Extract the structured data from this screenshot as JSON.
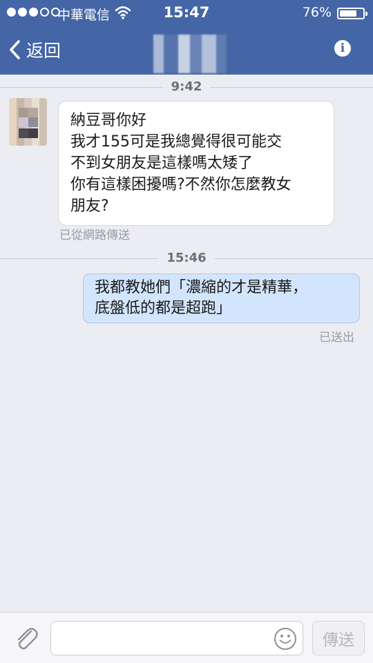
{
  "status_bar": {
    "carrier": "中華電信",
    "time": "15:47",
    "battery_text": "76%",
    "battery_level": 0.76,
    "signal_dots_filled": 3,
    "signal_dots_total": 5
  },
  "nav": {
    "back_label": "返回",
    "icons": {
      "back": "chevron-left-icon",
      "info": "info-icon"
    }
  },
  "conversation": {
    "divider_1_time": "9:42",
    "incoming": {
      "lines": [
        "納豆哥你好",
        "我才155可是我總覺得很可能交",
        "不到女朋友是這樣嗎太矮了",
        "你有這樣困擾嗎?不然你怎麼教女",
        "朋友?"
      ],
      "status": "已從網路傳送"
    },
    "divider_2_time": "15:46",
    "outgoing": {
      "lines": [
        "我都教她們「濃縮的才是精華，",
        "底盤低的都是超跑」"
      ],
      "status": "已送出"
    }
  },
  "input_bar": {
    "placeholder": "",
    "value": "",
    "send_label": "傳送",
    "icons": {
      "attach": "paperclip-icon",
      "emoji": "smiley-icon"
    }
  },
  "colors": {
    "header": "#4465a6",
    "background": "#ecedf2",
    "incoming_bubble": "#ffffff",
    "outgoing_bubble": "#d2e5fc"
  }
}
